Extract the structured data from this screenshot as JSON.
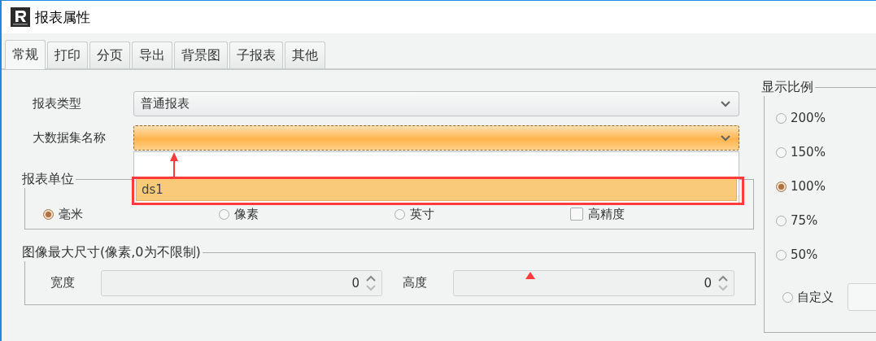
{
  "window": {
    "title": "报表属性"
  },
  "tabs": [
    {
      "label": "常规",
      "selected": true
    },
    {
      "label": "打印",
      "selected": false
    },
    {
      "label": "分页",
      "selected": false
    },
    {
      "label": "导出",
      "selected": false
    },
    {
      "label": "背景图",
      "selected": false
    },
    {
      "label": "子报表",
      "selected": false
    },
    {
      "label": "其他",
      "selected": false
    }
  ],
  "fields": [
    {
      "label": "报表类型",
      "value": "普通报表",
      "focused": false
    },
    {
      "label": "大数据集名称",
      "focused": true,
      "dropdown": {
        "items": [
          {
            "label": "ds1",
            "selected": true
          }
        ]
      }
    }
  ],
  "unit_group": {
    "title": "报表单位",
    "options": [
      {
        "kind": "radio",
        "label": "毫米",
        "selected": true
      },
      {
        "kind": "radio",
        "label": "像素",
        "selected": false
      },
      {
        "kind": "radio",
        "label": "英寸",
        "selected": false
      },
      {
        "kind": "checkbox",
        "label": "高精度",
        "checked": false
      }
    ]
  },
  "size_group": {
    "title": "图像最大尺寸(像素,0为不限制)",
    "fields": [
      {
        "label": "宽度",
        "value": "0"
      },
      {
        "label": "高度",
        "value": "0"
      }
    ]
  },
  "zoom_group": {
    "title": "显示比例",
    "options": [
      {
        "kind": "preset",
        "label": "200%",
        "selected": false
      },
      {
        "kind": "preset",
        "label": "150%",
        "selected": false
      },
      {
        "kind": "preset",
        "label": "100%",
        "selected": true
      },
      {
        "kind": "preset",
        "label": "75%",
        "selected": false
      },
      {
        "kind": "preset",
        "label": "50%",
        "selected": false
      },
      {
        "kind": "custom",
        "label": "自定义",
        "selected": false
      }
    ]
  }
}
